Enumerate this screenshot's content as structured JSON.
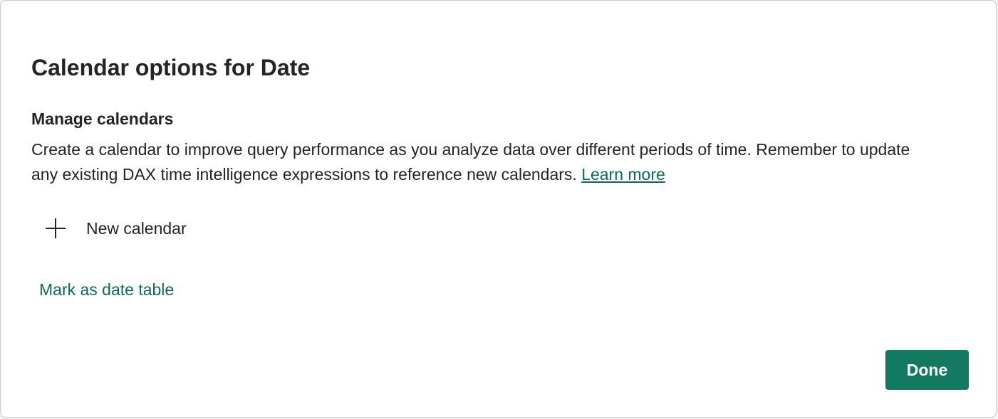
{
  "dialog": {
    "title": "Calendar options for Date",
    "section_heading": "Manage calendars",
    "description_line1": "Create a calendar to improve query performance as you analyze data over different periods of time. Remember to update",
    "description_line2": "any existing DAX time intelligence expressions to reference new calendars. ",
    "learn_more_label": "Learn more",
    "new_calendar_label": "New calendar",
    "new_calendar_icon": "plus-icon",
    "mark_date_table_label": "Mark as date table",
    "done_label": "Done"
  },
  "colors": {
    "accent": "#137a62",
    "link": "#0e6b5a",
    "text": "#242424"
  }
}
